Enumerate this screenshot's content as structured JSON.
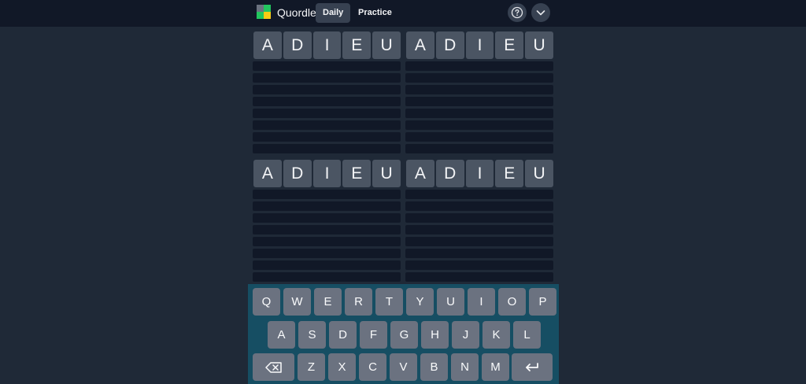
{
  "header": {
    "app_title": "Quordle",
    "tabs": [
      {
        "label": "Daily",
        "active": true
      },
      {
        "label": "Practice",
        "active": false
      }
    ],
    "icons": [
      "help-icon",
      "chevron-down-icon"
    ]
  },
  "boards": [
    {
      "guesses": [
        [
          "A",
          "D",
          "I",
          "E",
          "U"
        ]
      ],
      "empty_rows": 8
    },
    {
      "guesses": [
        [
          "A",
          "D",
          "I",
          "E",
          "U"
        ]
      ],
      "empty_rows": 8
    },
    {
      "guesses": [
        [
          "A",
          "D",
          "I",
          "E",
          "U"
        ]
      ],
      "empty_rows": 8
    },
    {
      "guesses": [
        [
          "A",
          "D",
          "I",
          "E",
          "U"
        ]
      ],
      "empty_rows": 8
    }
  ],
  "keyboard": {
    "rows": [
      [
        "Q",
        "W",
        "E",
        "R",
        "T",
        "Y",
        "U",
        "I",
        "O",
        "P"
      ],
      [
        "A",
        "S",
        "D",
        "F",
        "G",
        "H",
        "J",
        "K",
        "L"
      ],
      [
        "Z",
        "X",
        "C",
        "V",
        "B",
        "N",
        "M"
      ]
    ],
    "special_keys": {
      "backspace": "backspace-icon",
      "enter": "enter-icon"
    }
  },
  "colors": {
    "background": "#1f2937",
    "topbar": "#111827",
    "tile": "#4b5563",
    "empty_row": "#111827",
    "keyboard_bg": "#164e63",
    "key": "#6b7280"
  }
}
